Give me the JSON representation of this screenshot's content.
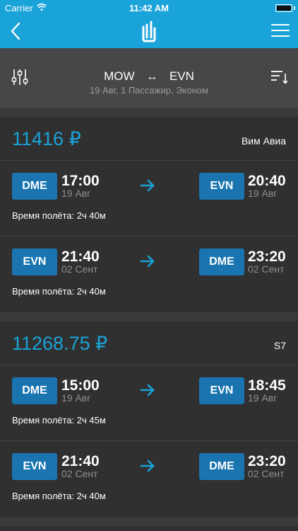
{
  "status_bar": {
    "carrier": "Carrier",
    "time": "11:42 AM"
  },
  "nav": {
    "back_icon": "chevron-left-icon",
    "logo_icon": "app-logo-icon",
    "menu_icon": "hamburger-menu-icon"
  },
  "search": {
    "origin": "MOW",
    "destination": "EVN",
    "route_arrow": "↔",
    "details": "19 Авг, 1 Пассажир, Эконом"
  },
  "colors": {
    "accent": "#1aa3d8",
    "badge": "#1a74b0",
    "background": "#3a3a3a",
    "card": "#303030"
  },
  "results": [
    {
      "price": "11416 ₽",
      "airline": "Вим Авиа",
      "legs": [
        {
          "from_code": "DME",
          "depart_time": "17:00",
          "depart_date": "19 Авг",
          "to_code": "EVN",
          "arrive_time": "20:40",
          "arrive_date": "19 Авг",
          "duration": "Время полёта: 2ч 40м"
        },
        {
          "from_code": "EVN",
          "depart_time": "21:40",
          "depart_date": "02 Сент",
          "to_code": "DME",
          "arrive_time": "23:20",
          "arrive_date": "02 Сент",
          "duration": "Время полёта: 2ч 40м"
        }
      ]
    },
    {
      "price": "11268.75 ₽",
      "airline": "S7",
      "legs": [
        {
          "from_code": "DME",
          "depart_time": "15:00",
          "depart_date": "19 Авг",
          "to_code": "EVN",
          "arrive_time": "18:45",
          "arrive_date": "19 Авг",
          "duration": "Время полёта: 2ч 45м"
        },
        {
          "from_code": "EVN",
          "depart_time": "21:40",
          "depart_date": "02 Сент",
          "to_code": "DME",
          "arrive_time": "23:20",
          "arrive_date": "02 Сент",
          "duration": "Время полёта: 2ч 40м"
        }
      ]
    }
  ]
}
